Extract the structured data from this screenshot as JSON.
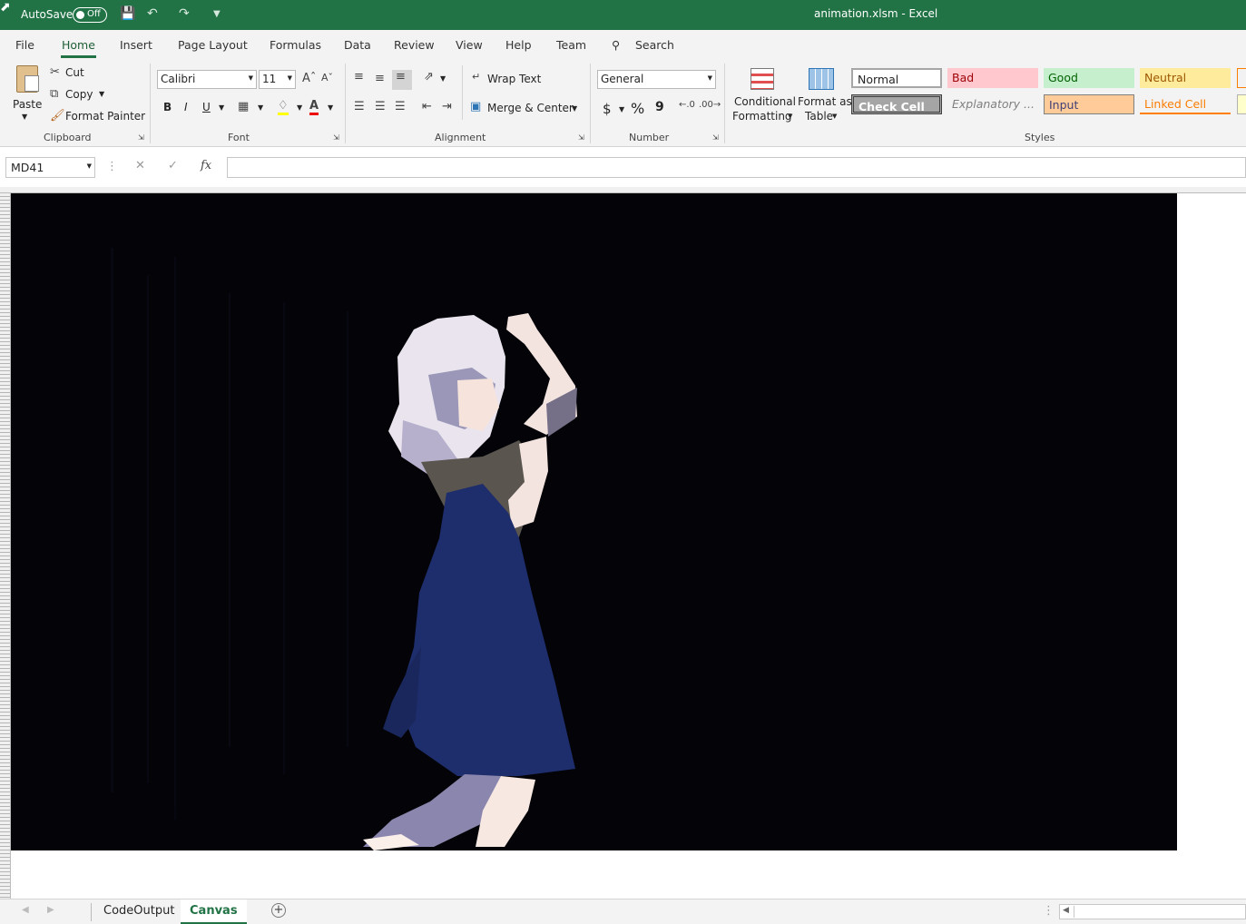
{
  "titlebar": {
    "autosave_label": "AutoSave",
    "toggle_label": "Off",
    "title": "animation.xlsm  -  Excel"
  },
  "menu": {
    "tabs": [
      "File",
      "Home",
      "Insert",
      "Page Layout",
      "Formulas",
      "Data",
      "Review",
      "View",
      "Help",
      "Team"
    ],
    "active": "Home",
    "search": "Search"
  },
  "ribbon": {
    "clipboard": {
      "paste": "Paste",
      "cut": "Cut",
      "copy": "Copy",
      "format_painter": "Format Painter",
      "label": "Clipboard"
    },
    "font": {
      "name": "Calibri",
      "size": "11",
      "bold": "B",
      "italic": "I",
      "underline": "U",
      "label": "Font"
    },
    "alignment": {
      "wrap_text": "Wrap Text",
      "merge_center": "Merge & Center",
      "label": "Alignment"
    },
    "number": {
      "format": "General",
      "currency": "$",
      "percent": "%",
      "comma": "9",
      "label": "Number"
    },
    "styles": {
      "conditional_1": "Conditional",
      "conditional_2": "Formatting",
      "format_table_1": "Format as",
      "format_table_2": "Table",
      "label": "Styles",
      "cells": [
        {
          "label": "Normal"
        },
        {
          "label": "Bad"
        },
        {
          "label": "Good"
        },
        {
          "label": "Neutral"
        },
        {
          "label": "Check Cell"
        },
        {
          "label": "Explanatory ..."
        },
        {
          "label": "Input"
        },
        {
          "label": "Linked Cell"
        }
      ]
    }
  },
  "formula_bar": {
    "name_box": "MD41",
    "fx": "fx",
    "formula": ""
  },
  "sheets": {
    "tabs": [
      "CodeOutput",
      "Canvas"
    ],
    "active": "Canvas"
  },
  "colors": {
    "excel_green": "#217346",
    "canvas_bg": "#030308",
    "dress": "#1e2d6b",
    "hair": "#e8e4ef",
    "skin": "#fbe8dc"
  }
}
